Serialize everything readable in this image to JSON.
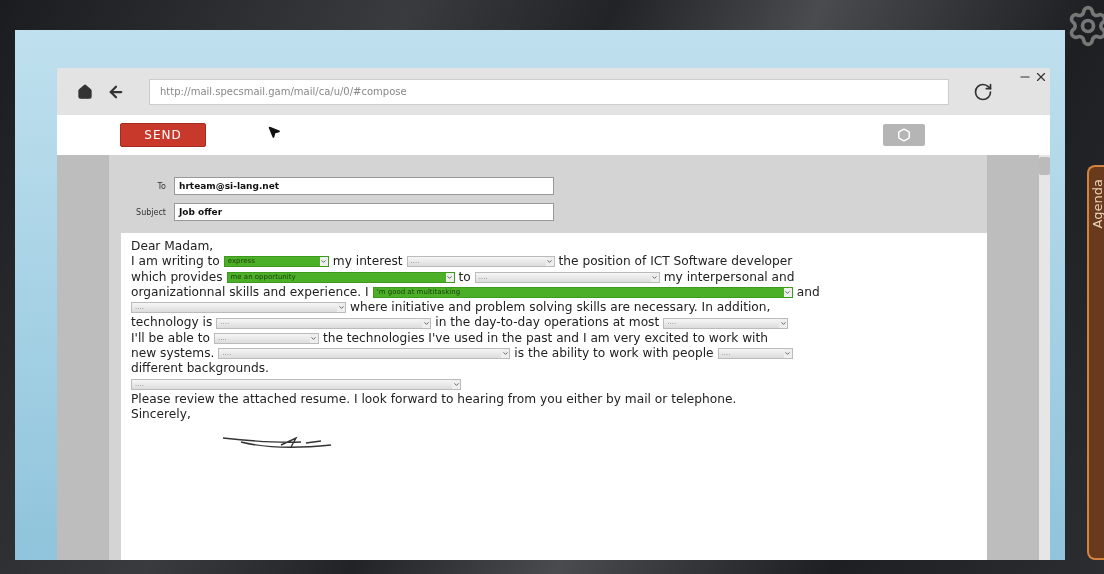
{
  "browser": {
    "url": "http://mail.specsmail.gam/mail/ca/u/0/#compose"
  },
  "toolbar": {
    "send_label": "SEND"
  },
  "compose": {
    "to_label": "To",
    "to": "hrteam@si-lang.net",
    "subject_label": "Subject",
    "subject": "Job offer",
    "letter": [
      [
        {
          "kind": "text",
          "text": "Dear Madam,"
        }
      ],
      [
        {
          "kind": "text",
          "text": "I am writing to"
        },
        {
          "kind": "select",
          "value": "express",
          "filled": true
        },
        {
          "kind": "text",
          "text": "my interest"
        },
        {
          "kind": "select",
          "value": "....",
          "filled": false
        },
        {
          "kind": "text",
          "text": "the position of ICT Software developer"
        }
      ],
      [
        {
          "kind": "text",
          "text": "which provides"
        },
        {
          "kind": "select",
          "value": "me an opportunity",
          "filled": true
        },
        {
          "kind": "text",
          "text": "to"
        },
        {
          "kind": "select",
          "value": "....",
          "filled": false
        },
        {
          "kind": "text",
          "text": "my interpersonal and"
        }
      ],
      [
        {
          "kind": "text",
          "text": "organizationnal skills and experience. I"
        },
        {
          "kind": "select",
          "value": "'m good at multitasking",
          "filled": true
        },
        {
          "kind": "text",
          "text": "and"
        }
      ],
      [
        {
          "kind": "select",
          "value": "....",
          "filled": false
        },
        {
          "kind": "text",
          "text": "where initiative and problem solving skills are necessary. In addition,"
        }
      ],
      [
        {
          "kind": "text",
          "text": "technology is"
        },
        {
          "kind": "select",
          "value": "....",
          "filled": false
        },
        {
          "kind": "text",
          "text": "in the day-to-day operations at most"
        },
        {
          "kind": "select",
          "value": "....",
          "filled": false
        }
      ],
      [
        {
          "kind": "text",
          "text": "I'll be able to"
        },
        {
          "kind": "select",
          "value": "....",
          "filled": false
        },
        {
          "kind": "text",
          "text": "the technologies I've used in the past and I am very excited to work with"
        }
      ],
      [
        {
          "kind": "text",
          "text": "new systems."
        },
        {
          "kind": "select",
          "value": "....",
          "filled": false
        },
        {
          "kind": "text",
          "text": "is the ability to work with people"
        },
        {
          "kind": "select",
          "value": "....",
          "filled": false
        }
      ],
      [
        {
          "kind": "text",
          "text": "different backgrounds."
        }
      ],
      [
        {
          "kind": "select",
          "value": "....",
          "filled": false
        }
      ],
      [
        {
          "kind": "text",
          "text": "Please review the attached resume. I look forward to hearing from you either by mail or telephone."
        }
      ],
      [
        {
          "kind": "text",
          "text": "Sincerely,"
        }
      ]
    ]
  },
  "side_tab": {
    "label": "Agenda"
  }
}
